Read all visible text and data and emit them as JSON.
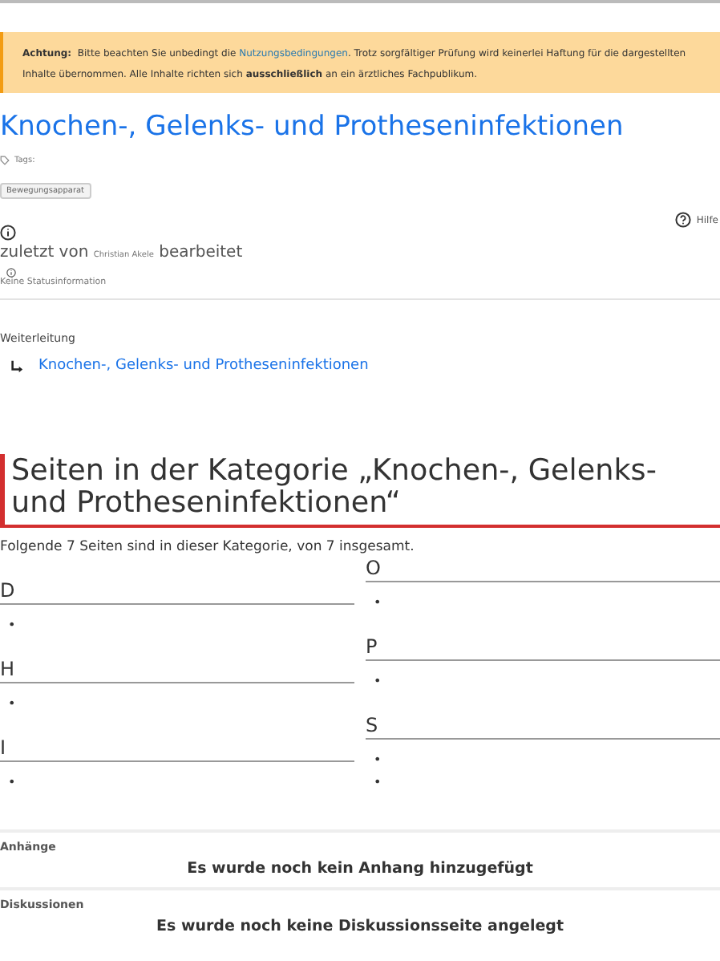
{
  "notice": {
    "label": "Achtung:",
    "text": "Bitte beachten Sie unbedingt die",
    "link": "Nutzungsbedingungen",
    "rest": ". Trotz sorgfältiger Prüfung wird keinerlei Haftung für die dargestellten Inhalte übernommen. Alle Inhalte richten sich **ausschließlich** an ein ärztliches Fachpublikum."
  },
  "title": "Knochen-, Gelenks- und Protheseninfektionen",
  "tags": {
    "label": "Tags:",
    "items": [
      "Bewegungsapparat"
    ]
  },
  "help": "Hilfe",
  "edited": {
    "prefix": "zuletzt von",
    "author": "Christian Akele",
    "suffix": "bearbeitet"
  },
  "status": "Keine Statusinformation",
  "redirect": {
    "label": "Weiterleitung",
    "link": "Knochen-, Gelenks- und Protheseninfektionen"
  },
  "category": {
    "heading": "Seiten in der Kategorie „Knochen-, Gelenks- und Protheseninfektionen“",
    "summary": "Folgende 7 Seiten sind in dieser Kategorie, von 7 insgesamt.",
    "columns": [
      [
        {
          "letter": "D",
          "items": [
            "•"
          ]
        },
        {
          "letter": "H",
          "items": [
            "•"
          ]
        },
        {
          "letter": "I",
          "items": [
            "•"
          ]
        }
      ],
      [
        {
          "letter": "O",
          "items": [
            "•"
          ]
        },
        {
          "letter": "P",
          "items": [
            "•"
          ]
        },
        {
          "letter": "S",
          "items": [
            "•",
            "•"
          ]
        }
      ]
    ]
  },
  "sections": [
    {
      "label": "Anhänge",
      "message": "Es wurde noch kein Anhang hinzugefügt"
    },
    {
      "label": "Diskussionen",
      "message": "Es wurde noch keine Diskussionsseite angelegt"
    }
  ]
}
